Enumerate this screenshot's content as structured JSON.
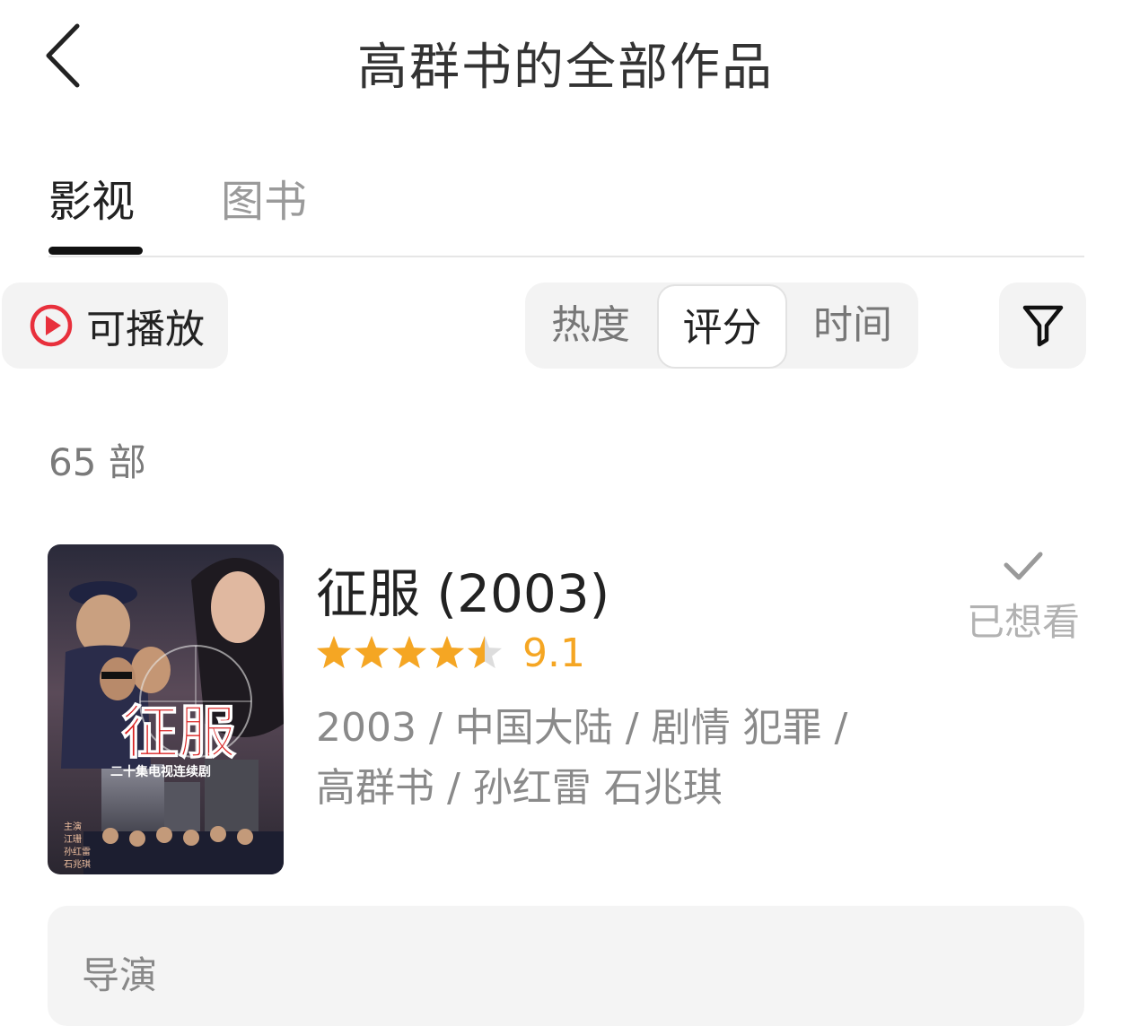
{
  "header": {
    "title": "高群书的全部作品"
  },
  "tabs": [
    {
      "label": "影视",
      "active": true
    },
    {
      "label": "图书",
      "active": false
    }
  ],
  "filters": {
    "playable_label": "可播放",
    "sort_options": [
      "热度",
      "评分",
      "时间"
    ],
    "sort_selected": "评分"
  },
  "count_text": "65 部",
  "item": {
    "title": "征服 (2003)",
    "rating_value": "9.1",
    "stars": 4.5,
    "meta_line1": "2003 / 中国大陆 / 剧情 犯罪 /",
    "meta_line2": "高群书 / 孙红雷 石兆琪",
    "wish_label": "已想看",
    "poster": {
      "title_text": "征服",
      "subtitle_text": "二十集电视连续剧",
      "cast_label": "主演",
      "cast": [
        "江珊",
        "孙红雷",
        "石兆琪"
      ]
    }
  },
  "director_section": {
    "label": "导演"
  },
  "colors": {
    "accent_red": "#e8303c",
    "star": "#f5a623",
    "star_empty": "#dddddd"
  }
}
